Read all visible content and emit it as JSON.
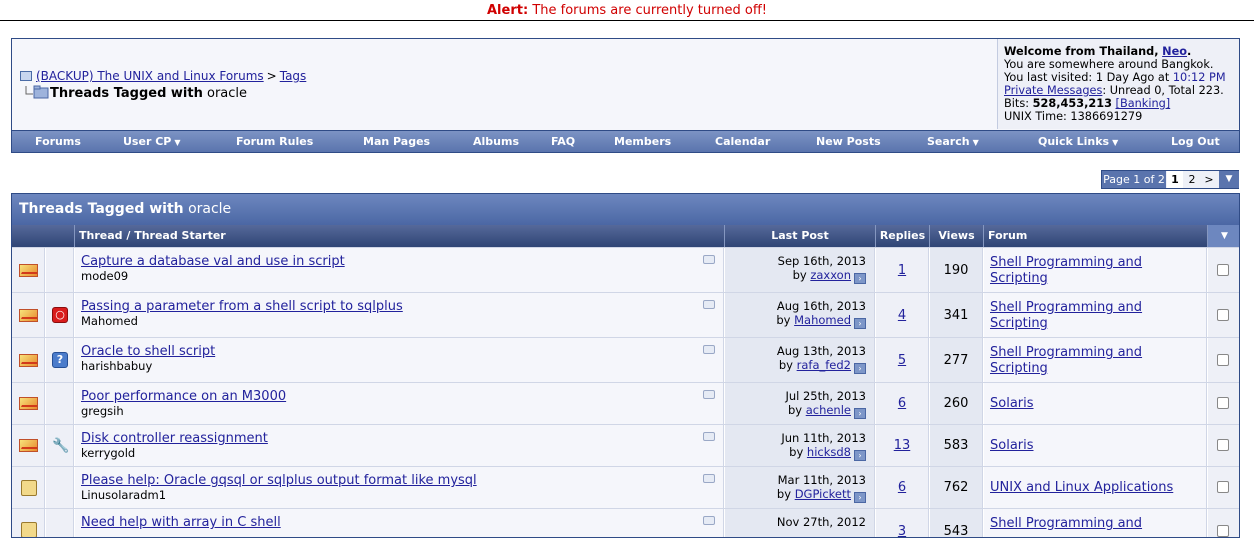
{
  "alert": {
    "label": "Alert:",
    "message": "The forums are currently turned off!"
  },
  "breadcrumb": {
    "home": "(BACKUP) The UNIX and Linux Forums",
    "separator": ">",
    "tags": "Tags",
    "current_prefix": "Threads Tagged with",
    "current_tag": "oracle"
  },
  "welcome": {
    "greeting": "Welcome from Thailand,",
    "username": "Neo",
    "location": "You are somewhere around Bangkok.",
    "last_visit_label": "You last visited: 1 Day Ago at",
    "last_visit_time": "10:12 PM",
    "pm_link": "Private Messages",
    "pm_status": ": Unread 0, Total 223.",
    "bits_label": "Bits:",
    "bits_value": "528,453,213",
    "banking": "[Banking]",
    "unix_time": "UNIX Time: 1386691279"
  },
  "navbar": {
    "items": [
      {
        "label": "Forums"
      },
      {
        "label": "User CP",
        "dropdown": true
      },
      {
        "label": "Forum Rules"
      },
      {
        "label": "Man Pages"
      },
      {
        "label": "Albums"
      },
      {
        "label": "FAQ"
      },
      {
        "label": "Members"
      },
      {
        "label": "Calendar"
      },
      {
        "label": "New Posts"
      },
      {
        "label": "Search",
        "dropdown": true
      },
      {
        "label": "Quick Links",
        "dropdown": true
      },
      {
        "label": "Log Out"
      }
    ]
  },
  "pagination": {
    "label": "Page 1 of 2",
    "current": "1",
    "next_page": "2",
    "next": ">",
    "menu": "▼"
  },
  "table": {
    "title_prefix": "Threads Tagged with",
    "title_tag": "oracle",
    "columns": {
      "thread": "Thread / Thread Starter",
      "last_post": "Last Post",
      "replies": "Replies",
      "views": "Views",
      "forum": "Forum",
      "options": "▼"
    },
    "rows": [
      {
        "icon": "envelope-icon",
        "thread_icon": "",
        "title": "Capture a database val and use in script",
        "starter": "mode09",
        "date": "Sep 16th, 2013",
        "by": "by",
        "last_user": "zaxxon",
        "replies": "1",
        "views": "190",
        "forum": "Shell Programming and Scripting"
      },
      {
        "icon": "envelope-icon",
        "thread_icon": "oracle",
        "title": "Passing a parameter from a shell script to sqlplus",
        "starter": "Mahomed",
        "date": "Aug 16th, 2013",
        "by": "by",
        "last_user": "Mahomed",
        "replies": "4",
        "views": "341",
        "forum": "Shell Programming and Scripting"
      },
      {
        "icon": "envelope-icon",
        "thread_icon": "question",
        "title": "Oracle to shell script",
        "starter": "harishbabuy",
        "date": "Aug 13th, 2013",
        "by": "by",
        "last_user": "rafa_fed2",
        "replies": "5",
        "views": "277",
        "forum": "Shell Programming and Scripting"
      },
      {
        "icon": "envelope-icon",
        "thread_icon": "",
        "title": "Poor performance on an M3000",
        "starter": "gregsih",
        "date": "Jul 25th, 2013",
        "by": "by",
        "last_user": "achenle",
        "replies": "6",
        "views": "260",
        "forum": "Solaris"
      },
      {
        "icon": "envelope-icon",
        "thread_icon": "wrench",
        "title": "Disk controller reassignment",
        "starter": "kerrygold",
        "date": "Jun 11th, 2013",
        "by": "by",
        "last_user": "hicksd8",
        "replies": "13",
        "views": "583",
        "forum": "Solaris"
      },
      {
        "icon": "lock-icon",
        "thread_icon": "",
        "title": "Please help: Oracle gqsql or sqlplus output format like mysql",
        "starter": "Linusolaradm1",
        "date": "Mar 11th, 2013",
        "by": "by",
        "last_user": "DGPickett",
        "replies": "6",
        "views": "762",
        "forum": "UNIX and Linux Applications"
      },
      {
        "icon": "lock-icon",
        "thread_icon": "",
        "title": "Need help with array in C shell",
        "starter": "",
        "date": "Nov 27th, 2012",
        "by": "",
        "last_user": "",
        "replies": "3",
        "views": "543",
        "forum": "Shell Programming and"
      }
    ]
  },
  "colors": {
    "alert": "#d00000",
    "link": "#22229c",
    "navbar": "#5a74ad",
    "table_header": "#2f4575"
  }
}
